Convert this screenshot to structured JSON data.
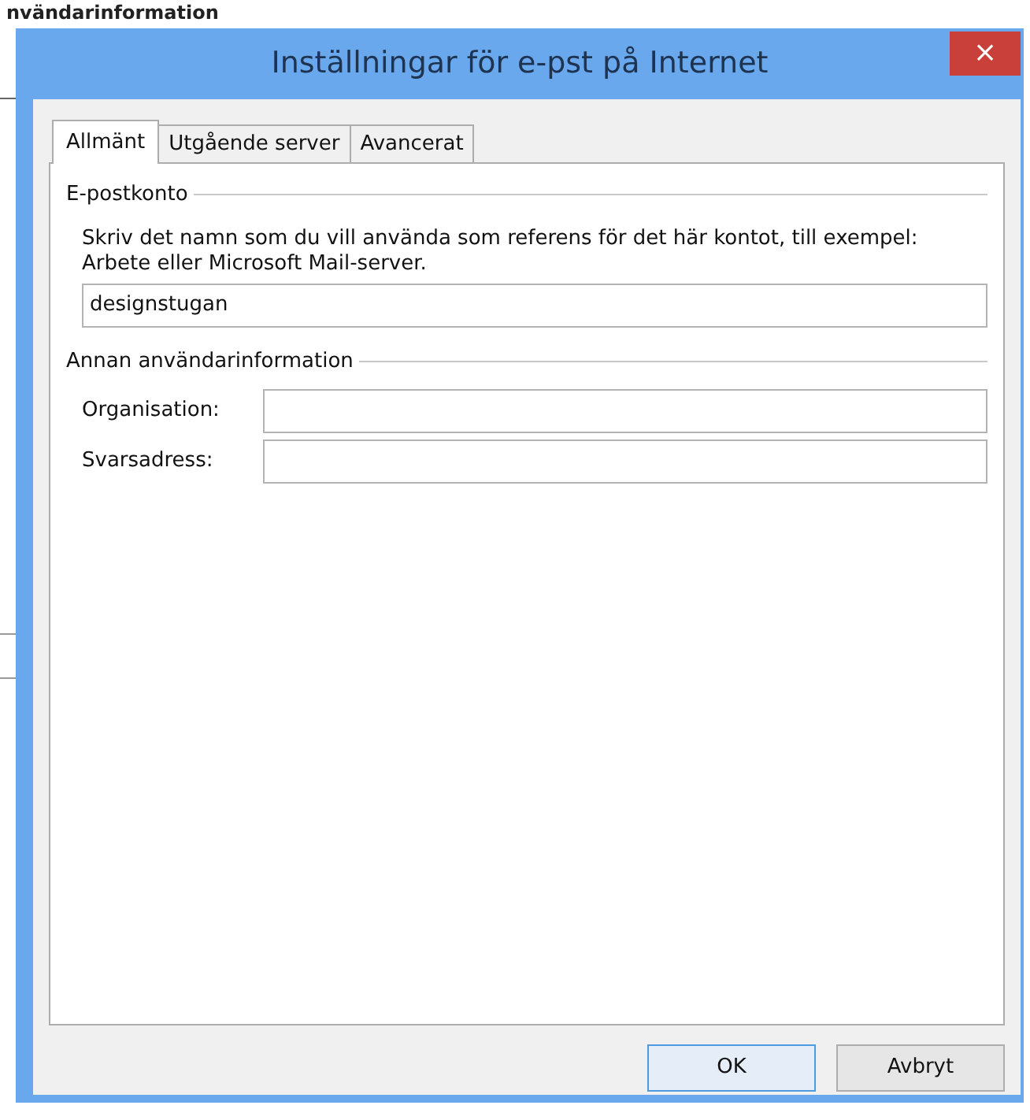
{
  "background_window": {
    "heading": "nvändarinformation"
  },
  "window": {
    "title": "Inställningar för e-pst på Internet",
    "close": "×"
  },
  "tabs": [
    {
      "label": "Allmänt",
      "selected": true
    },
    {
      "label": "Utgående server",
      "selected": false
    },
    {
      "label": "Avancerat",
      "selected": false
    }
  ],
  "account_group": {
    "legend": "E-postkonto",
    "description": "Skriv det namn som du vill använda som referens för det här kontot, till exempel: Arbete eller Microsoft Mail-server.",
    "value": "designstugan"
  },
  "user_group": {
    "legend": "Annan användarinformation",
    "fields": [
      {
        "label": "Organisation:"
      },
      {
        "label": "Svarsadress:"
      }
    ]
  },
  "buttons": [
    {
      "label": "OK",
      "default": true
    },
    {
      "label": "Avbryt",
      "default": false
    }
  ]
}
